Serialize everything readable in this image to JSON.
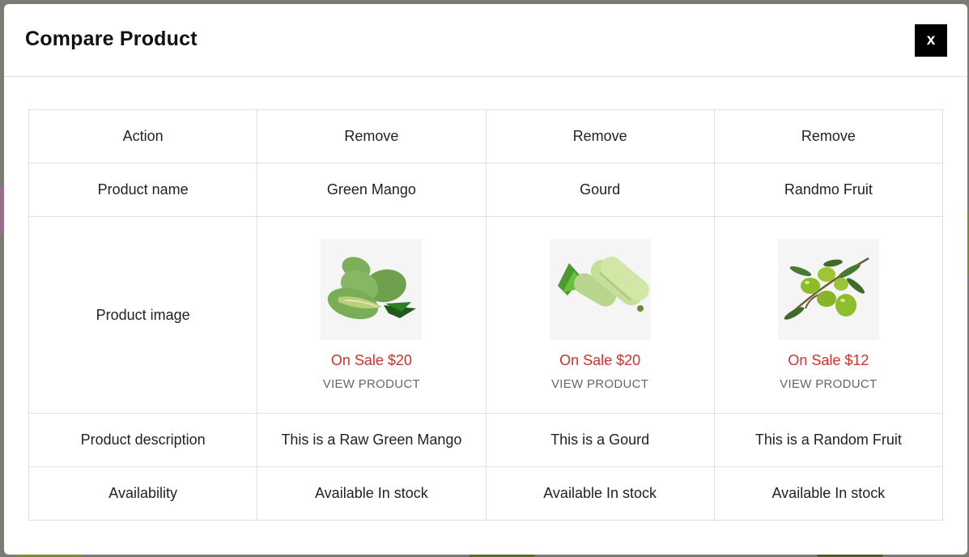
{
  "modal": {
    "title": "Compare Product",
    "close_label": "x"
  },
  "table": {
    "row_labels": {
      "action": "Action",
      "product_name": "Product name",
      "product_image": "Product image",
      "product_description": "Product description",
      "availability": "Availability"
    },
    "products": [
      {
        "action": "Remove",
        "name": "Green Mango",
        "image_icon": "green-mango-image",
        "price": "On Sale $20",
        "view_label": "VIEW PRODUCT",
        "description": "This is a Raw Green Mango",
        "availability": "Available In stock"
      },
      {
        "action": "Remove",
        "name": "Gourd",
        "image_icon": "gourd-image",
        "price": "On Sale $20",
        "view_label": "VIEW PRODUCT",
        "description": "This is a Gourd",
        "availability": "Available In stock"
      },
      {
        "action": "Remove",
        "name": "Randmo Fruit",
        "image_icon": "olive-fruit-image",
        "price": "On Sale $12",
        "view_label": "VIEW PRODUCT",
        "description": "This is a Random Fruit",
        "availability": "Available In stock"
      }
    ]
  },
  "colors": {
    "price": "#d0312d",
    "close_button_bg": "#000000",
    "border": "#e0e0e0"
  }
}
